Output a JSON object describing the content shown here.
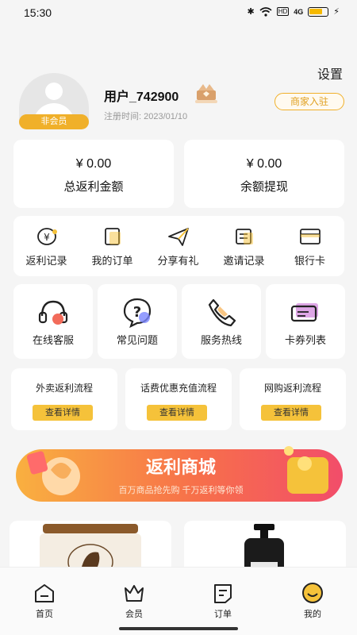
{
  "status_bar": {
    "time": "15:30",
    "hd_label": "HD",
    "signal_label": "4G"
  },
  "header": {
    "settings_label": "设置",
    "username": "用户_742900",
    "register_time": "注册时间: 2023/01/10",
    "member_badge": "非会员",
    "merchant_button": "商家入驻"
  },
  "balances": [
    {
      "value": "¥ 0.00",
      "label": "总返利金额"
    },
    {
      "value": "¥ 0.00",
      "label": "余额提现"
    }
  ],
  "quick_menu": [
    {
      "label": "返利记录",
      "icon": "rebate-icon"
    },
    {
      "label": "我的订单",
      "icon": "order-icon"
    },
    {
      "label": "分享有礼",
      "icon": "share-icon"
    },
    {
      "label": "邀请记录",
      "icon": "invite-icon"
    },
    {
      "label": "银行卡",
      "icon": "bank-card-icon"
    }
  ],
  "services": [
    {
      "label": "在线客服",
      "icon": "headset-icon"
    },
    {
      "label": "常见问题",
      "icon": "question-icon"
    },
    {
      "label": "服务热线",
      "icon": "phone-icon"
    },
    {
      "label": "卡券列表",
      "icon": "coupon-icon"
    }
  ],
  "flows": [
    {
      "title": "外卖返利流程",
      "button": "查看详情"
    },
    {
      "title": "话费优惠充值流程",
      "button": "查看详情"
    },
    {
      "title": "网购返利流程",
      "button": "查看详情"
    }
  ],
  "banner": {
    "title": "返利商城",
    "subtitle": "百万商品抢先购  千万返利等你领"
  },
  "tabs": [
    {
      "label": "首页",
      "icon": "home-icon"
    },
    {
      "label": "会员",
      "icon": "crown-icon"
    },
    {
      "label": "订单",
      "icon": "order-icon"
    },
    {
      "label": "我的",
      "icon": "smile-icon"
    }
  ],
  "colors": {
    "accent": "#F5C23A",
    "banner_gradient_start": "#F9A030",
    "banner_gradient_end": "#F25A6A"
  }
}
